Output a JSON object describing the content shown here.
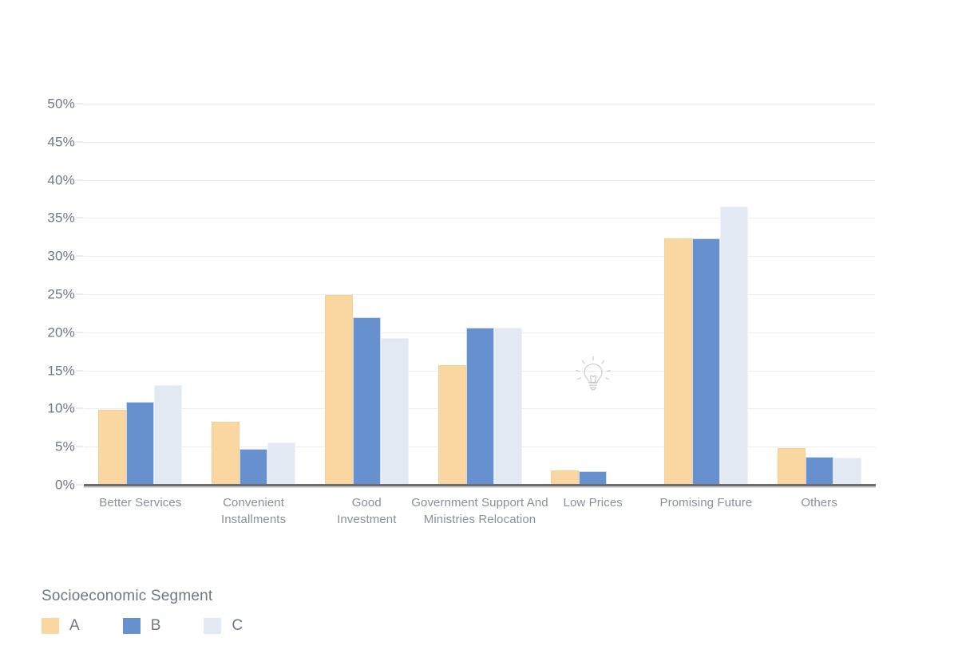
{
  "chart_data": {
    "type": "bar",
    "title": "",
    "subtitle": "",
    "xlabel": "",
    "ylabel": "",
    "ylim": [
      0,
      50
    ],
    "ytick_labels": [
      "0%",
      "5%",
      "10%",
      "15%",
      "20%",
      "25%",
      "30%",
      "35%",
      "40%",
      "45%",
      "50%"
    ],
    "ytick_values": [
      0,
      5,
      10,
      15,
      20,
      25,
      30,
      35,
      40,
      45,
      50
    ],
    "grid": true,
    "legend_position": "bottom-left",
    "legend_title": "Socioeconomic Segment",
    "categories": [
      "Better Services",
      "Convenient Installments",
      "Good Investment",
      "Government Support And Ministries Relocation",
      "Low Prices",
      "Promising Future",
      "Others"
    ],
    "category_label_lines": [
      [
        "Better Services"
      ],
      [
        "Convenient",
        "Installments"
      ],
      [
        "Good",
        "Investment"
      ],
      [
        "Government Support And",
        "Ministries Relocation"
      ],
      [
        "Low Prices"
      ],
      [
        "Promising Future"
      ],
      [
        "Others"
      ]
    ],
    "series": [
      {
        "name": "A",
        "color": "#fad6a0",
        "values": [
          9.8,
          8.3,
          24.9,
          15.7,
          1.9,
          32.3,
          4.8
        ]
      },
      {
        "name": "B",
        "color": "#6691ce",
        "values": [
          10.9,
          4.7,
          22.0,
          20.6,
          1.8,
          32.3,
          3.7
        ]
      },
      {
        "name": "C",
        "color": "#e2e9f3",
        "values": [
          13.1,
          5.5,
          19.3,
          20.6,
          null,
          36.5,
          3.6
        ]
      }
    ],
    "annotations": [
      {
        "type": "icon",
        "name": "lightbulb-icon",
        "x_category": "Low Prices",
        "y_value": 14.5
      }
    ]
  },
  "legend": {
    "title": "Socioeconomic Segment",
    "items": [
      {
        "label": "A",
        "color": "#fad6a0"
      },
      {
        "label": "B",
        "color": "#6691ce"
      },
      {
        "label": "C",
        "color": "#e2e9f3"
      }
    ]
  },
  "colors": {
    "series_a": "#fad6a0",
    "series_b": "#6691ce",
    "series_c": "#e2e9f3",
    "gridline": "#ededed",
    "axis": "#6d6d6d",
    "text": "#6f7782",
    "category_text": "#8a9099",
    "background": "#ffffff"
  }
}
